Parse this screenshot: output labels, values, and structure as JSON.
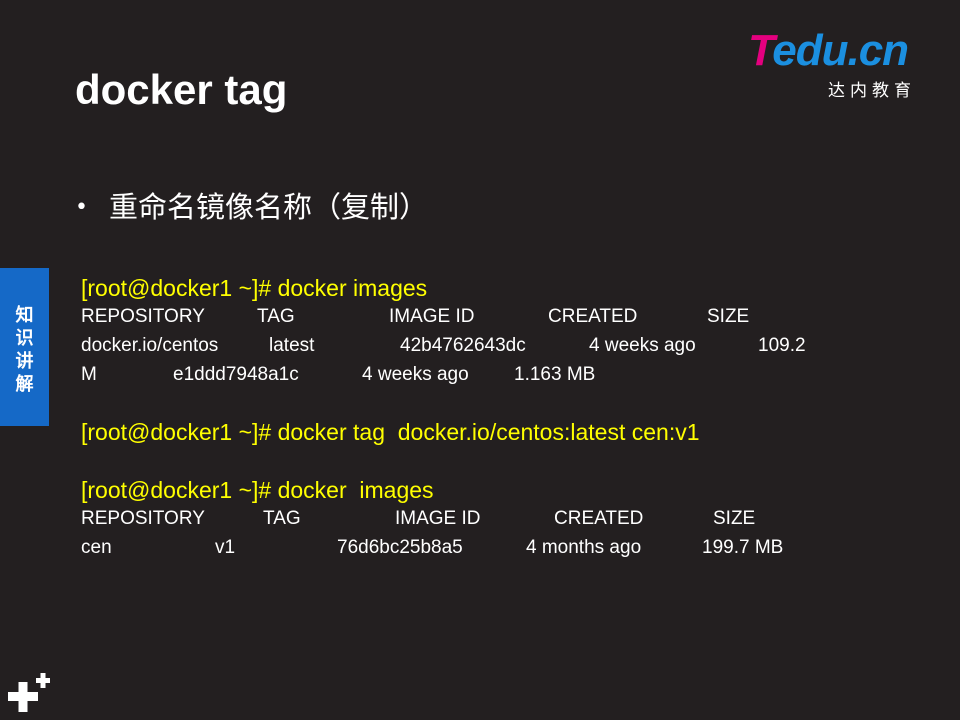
{
  "slide": {
    "title": "docker tag",
    "bullet": "重命名镜像名称（复制）",
    "side_tab": [
      "知",
      "识",
      "讲",
      "解"
    ],
    "logo": {
      "brand_t": "T",
      "brand_rest": "edu.cn",
      "subtitle": "达内教育"
    }
  },
  "block1": {
    "command": "[root@docker1 ~]# docker images",
    "headers": [
      "REPOSITORY",
      "TAG",
      "IMAGE ID",
      "CREATED",
      "SIZE"
    ],
    "row1": [
      "docker.io/centos",
      "latest",
      "42b4762643dc",
      "4 weeks ago",
      "109.2"
    ],
    "row2": [
      "M",
      "e1ddd7948a1c",
      "4 weeks ago",
      "1.163 MB"
    ]
  },
  "block2": {
    "command": "[root@docker1 ~]# docker tag  docker.io/centos:latest cen:v1"
  },
  "block3": {
    "command": "[root@docker1 ~]# docker  images",
    "headers": [
      "REPOSITORY",
      "TAG",
      "IMAGE ID",
      "CREATED",
      "SIZE"
    ],
    "row1": [
      "cen",
      "v1",
      "76d6bc25b8a5",
      "4 months ago",
      "199.7 MB"
    ]
  },
  "colors": {
    "background": "#231f20",
    "command": "#ffff00",
    "side_tab": "#1569c7",
    "logo_pink": "#e4007f",
    "logo_blue": "#1b8fe0"
  }
}
